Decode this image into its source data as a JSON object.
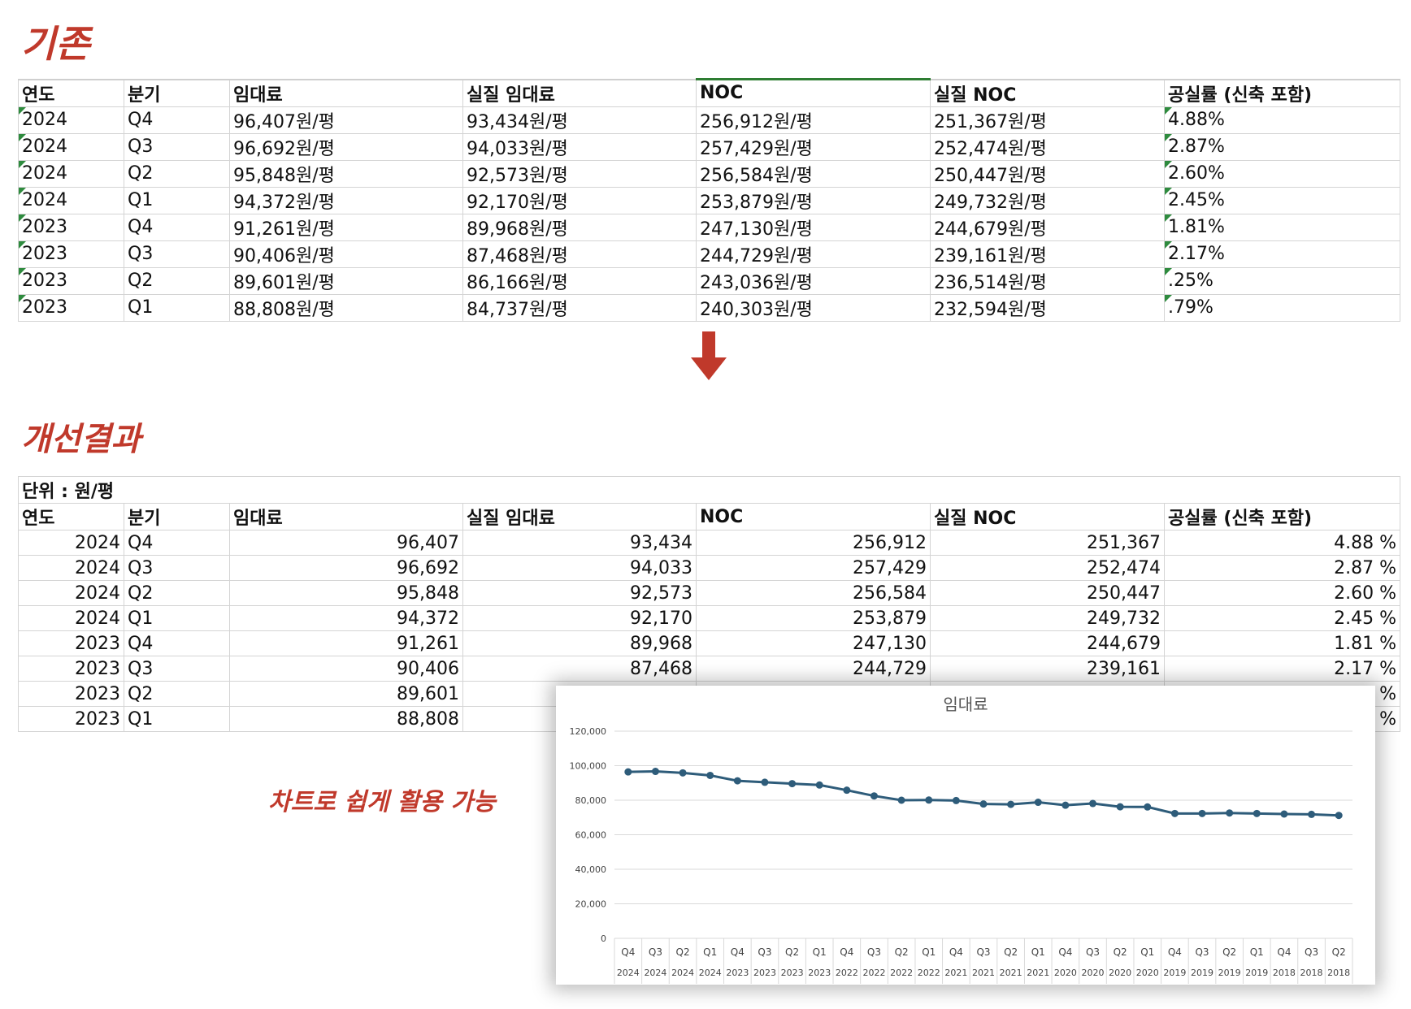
{
  "labels": {
    "before": "기존",
    "after": "개선결과",
    "chart_note": "차트로 쉽게 활용 가능"
  },
  "headers": [
    "연도",
    "분기",
    "임대료",
    "실질 임대료",
    "NOC",
    "실질 NOC",
    "공실률 (신축 포함)"
  ],
  "before_rows": [
    [
      "2024",
      "Q4",
      "96,407원/평",
      "93,434원/평",
      "256,912원/평",
      "251,367원/평",
      "4.88%"
    ],
    [
      "2024",
      "Q3",
      "96,692원/평",
      "94,033원/평",
      "257,429원/평",
      "252,474원/평",
      "2.87%"
    ],
    [
      "2024",
      "Q2",
      "95,848원/평",
      "92,573원/평",
      "256,584원/평",
      "250,447원/평",
      "2.60%"
    ],
    [
      "2024",
      "Q1",
      "94,372원/평",
      "92,170원/평",
      "253,879원/평",
      "249,732원/평",
      "2.45%"
    ],
    [
      "2023",
      "Q4",
      "91,261원/평",
      "89,968원/평",
      "247,130원/평",
      "244,679원/평",
      "1.81%"
    ],
    [
      "2023",
      "Q3",
      "90,406원/평",
      "87,468원/평",
      "244,729원/평",
      "239,161원/평",
      "2.17%"
    ],
    [
      "2023",
      "Q2",
      "89,601원/평",
      "86,166원/평",
      "243,036원/평",
      "236,514원/평",
      ".25%"
    ],
    [
      "2023",
      "Q1",
      "88,808원/평",
      "84,737원/평",
      "240,303원/평",
      "232,594원/평",
      ".79%"
    ]
  ],
  "after_unit": "단위 : 원/평",
  "after_rows": [
    [
      "2024",
      "Q4",
      "96,407",
      "93,434",
      "256,912",
      "251,367",
      "4.88 %"
    ],
    [
      "2024",
      "Q3",
      "96,692",
      "94,033",
      "257,429",
      "252,474",
      "2.87 %"
    ],
    [
      "2024",
      "Q2",
      "95,848",
      "92,573",
      "256,584",
      "250,447",
      "2.60 %"
    ],
    [
      "2024",
      "Q1",
      "94,372",
      "92,170",
      "253,879",
      "249,732",
      "2.45 %"
    ],
    [
      "2023",
      "Q4",
      "91,261",
      "89,968",
      "247,130",
      "244,679",
      "1.81 %"
    ],
    [
      "2023",
      "Q3",
      "90,406",
      "87,468",
      "244,729",
      "239,161",
      "2.17 %"
    ],
    [
      "2023",
      "Q2",
      "89,601",
      "",
      "",
      "",
      "%"
    ],
    [
      "2023",
      "Q1",
      "88,808",
      "",
      "",
      "",
      "%"
    ]
  ],
  "colors": {
    "annotation": "#c0392b",
    "line": "#2e5c7a",
    "flag": "#2e8b3e"
  },
  "chart_data": {
    "type": "line",
    "title": "임대료",
    "ylim": [
      0,
      120000
    ],
    "yticks": [
      "0",
      "20,000",
      "40,000",
      "60,000",
      "80,000",
      "100,000",
      "120,000"
    ],
    "grid": true,
    "categories_quarter": [
      "Q4",
      "Q3",
      "Q2",
      "Q1",
      "Q4",
      "Q3",
      "Q2",
      "Q1",
      "Q4",
      "Q3",
      "Q2",
      "Q1",
      "Q4",
      "Q3",
      "Q2",
      "Q1",
      "Q4",
      "Q3",
      "Q2",
      "Q1",
      "Q4",
      "Q3",
      "Q2",
      "Q1",
      "Q4",
      "Q3",
      "Q2"
    ],
    "categories_year": [
      "2024",
      "2024",
      "2024",
      "2024",
      "2023",
      "2023",
      "2023",
      "2023",
      "2022",
      "2022",
      "2022",
      "2022",
      "2021",
      "2021",
      "2021",
      "2021",
      "2020",
      "2020",
      "2020",
      "2020",
      "2019",
      "2019",
      "2019",
      "2019",
      "2018",
      "2018",
      "2018"
    ],
    "values": [
      96407,
      96692,
      95848,
      94372,
      91261,
      90406,
      89601,
      88808,
      85800,
      82500,
      80000,
      80100,
      79800,
      77800,
      77600,
      78800,
      77100,
      78100,
      76200,
      76100,
      72300,
      72300,
      72600,
      72300,
      72000,
      71800,
      71200
    ]
  }
}
